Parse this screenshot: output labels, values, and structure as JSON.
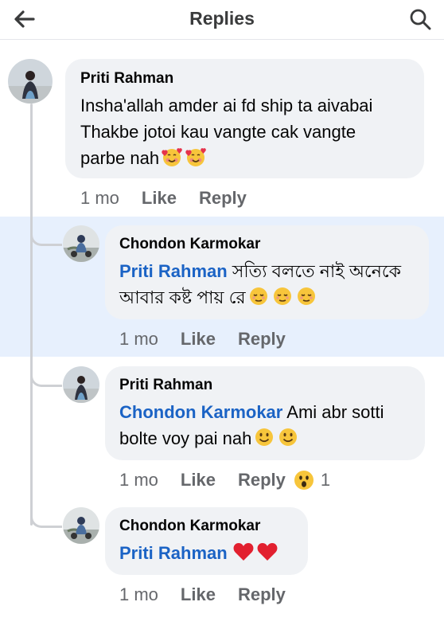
{
  "header": {
    "title": "Replies",
    "back_icon": "back-arrow-icon",
    "search_icon": "search-icon"
  },
  "colors": {
    "mention": "#1b63c5",
    "bubble": "#f0f2f5",
    "highlight": "#e7f0fd",
    "meta": "#65676b"
  },
  "comments": [
    {
      "author": "Priti Rahman",
      "lines": [
        "Insha'allah amder ai fd ship ta aivabai",
        "Thakbe jotoi kau vangte cak vangte",
        "parbe nah"
      ],
      "emoji": [
        "smiling-face-with-hearts",
        "smiling-face-with-hearts"
      ],
      "time": "1 mo",
      "like": "Like",
      "reply": "Reply"
    },
    {
      "author": "Chondon Karmokar",
      "mention": "Priti Rahman",
      "text_line1": "সত্যি বলতে নাই অনেকে",
      "text_line2": "আবার কষ্ট পায় রে",
      "emoji": [
        "relieved-face",
        "relieved-face",
        "relieved-face"
      ],
      "time": "1 mo",
      "like": "Like",
      "reply": "Reply"
    },
    {
      "author": "Priti Rahman",
      "mention": "Chondon Karmokar",
      "text_line1": "Ami abr sotti",
      "text_line2": "bolte voy pai nah",
      "emoji": [
        "slightly-smiling-face",
        "slightly-smiling-face"
      ],
      "time": "1 mo",
      "like": "Like",
      "reply": "Reply",
      "reaction": {
        "icon": "wow-reaction-icon",
        "count": "1"
      }
    },
    {
      "author": "Chondon Karmokar",
      "mention": "Priti Rahman",
      "emoji": [
        "red-heart",
        "red-heart"
      ],
      "time": "1 mo",
      "like": "Like",
      "reply": "Reply"
    }
  ]
}
